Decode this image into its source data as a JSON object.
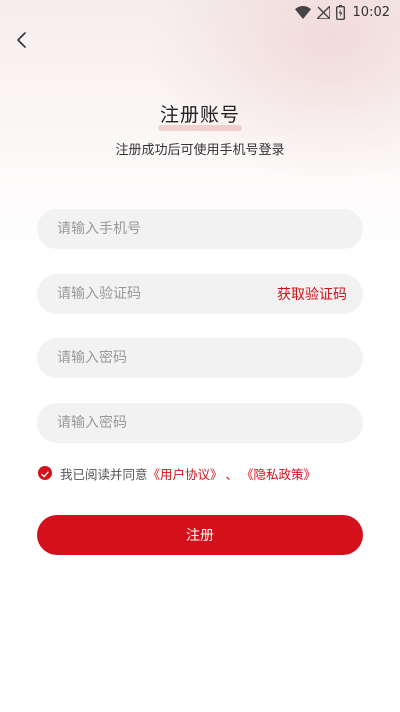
{
  "status_bar": {
    "time": "10:02",
    "icons": [
      "wifi-icon",
      "no-signal-icon",
      "battery-icon"
    ]
  },
  "header": {
    "back_icon": "chevron-left-icon",
    "title": "注册账号",
    "subtitle": "注册成功后可使用手机号登录"
  },
  "form": {
    "phone_placeholder": "请输入手机号",
    "phone_value": "",
    "code_placeholder": "请输入验证码",
    "code_value": "",
    "get_code_label": "获取验证码",
    "password_placeholder": "请输入密码",
    "password_value": "",
    "confirm_password_placeholder": "请输入密码",
    "confirm_password_value": ""
  },
  "agreement": {
    "checked": true,
    "text": "我已阅读并同意",
    "user_agreement": "《用户协议》",
    "separator": "、",
    "privacy_policy": "《隐私政策》"
  },
  "submit_label": "注册",
  "colors": {
    "accent": "#d4101a",
    "field_bg": "#f2f2f2",
    "placeholder": "#999999"
  }
}
